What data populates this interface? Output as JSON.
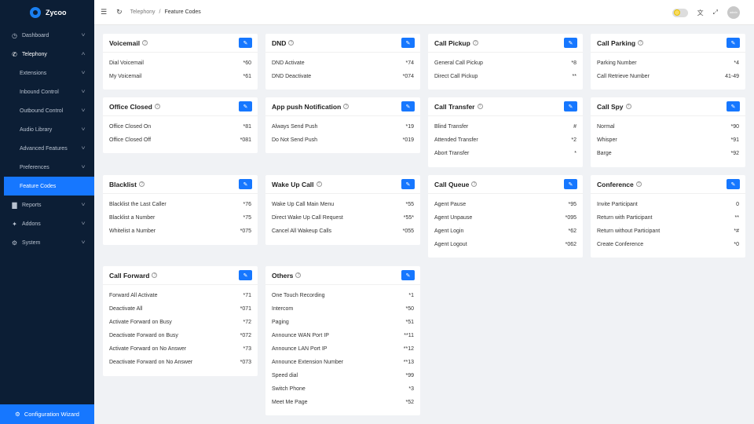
{
  "app": {
    "name": "Zycoo"
  },
  "sidebar": {
    "items": [
      {
        "label": "Dashboard",
        "icon": "dashboard-icon",
        "open": false
      },
      {
        "label": "Telephony",
        "icon": "phone-icon",
        "open": true
      },
      {
        "label": "Extensions",
        "sub": true
      },
      {
        "label": "Inbound Control",
        "sub": true
      },
      {
        "label": "Outbound Control",
        "sub": true
      },
      {
        "label": "Audio Library",
        "sub": true
      },
      {
        "label": "Advanced Features",
        "sub": true
      },
      {
        "label": "Preferences",
        "sub": true
      },
      {
        "label": "Feature Codes",
        "sub": true,
        "active": true
      },
      {
        "label": "Reports",
        "icon": "chart-icon"
      },
      {
        "label": "Addons",
        "icon": "addons-icon"
      },
      {
        "label": "System",
        "icon": "system-icon"
      }
    ],
    "wizard_label": "Configuration Wizard"
  },
  "header": {
    "breadcrumb": [
      "Telephony",
      "/",
      "Feature Codes"
    ],
    "avatar_text": "admin"
  },
  "cards": [
    {
      "title": "Voicemail",
      "rows": [
        [
          "Dial Voicemail",
          "*60"
        ],
        [
          "My Voicemail",
          "*61"
        ]
      ]
    },
    {
      "title": "DND",
      "rows": [
        [
          "DND Activate",
          "*74"
        ],
        [
          "DND Deactivate",
          "*074"
        ]
      ]
    },
    {
      "title": "Call Pickup",
      "rows": [
        [
          "General Call Pickup",
          "*8"
        ],
        [
          "Direct Call Pickup",
          "**"
        ]
      ]
    },
    {
      "title": "Call Parking",
      "rows": [
        [
          "Parking Number",
          "*4"
        ],
        [
          "Call Retrieve Number",
          "41-49"
        ]
      ]
    },
    {
      "title": "Office Closed",
      "rows": [
        [
          "Office Closed On",
          "*81"
        ],
        [
          "Office Closed Off",
          "*081"
        ]
      ]
    },
    {
      "title": "App push Notification",
      "rows": [
        [
          "Always Send Push",
          "*19"
        ],
        [
          "Do Not Send Push",
          "*019"
        ]
      ]
    },
    {
      "title": "Call Transfer",
      "rows": [
        [
          "Blind Transfer",
          "#"
        ],
        [
          "Attended Transfer",
          "*2"
        ],
        [
          "Abort Transfer",
          "*"
        ]
      ]
    },
    {
      "title": "Call Spy",
      "rows": [
        [
          "Normal",
          "*90"
        ],
        [
          "Whisper",
          "*91"
        ],
        [
          "Barge",
          "*92"
        ]
      ]
    },
    {
      "title": "Blacklist",
      "rows": [
        [
          "Blacklist the Last Caller",
          "*76"
        ],
        [
          "Blacklist a Number",
          "*75"
        ],
        [
          "Whitelist a Number",
          "*075"
        ]
      ]
    },
    {
      "title": "Wake Up Call",
      "rows": [
        [
          "Wake Up Call Main Menu",
          "*55"
        ],
        [
          "Direct Wake Up Call Request",
          "*55*"
        ],
        [
          "Cancel All Wakeup Calls",
          "*055"
        ]
      ]
    },
    {
      "title": "Call Queue",
      "rows": [
        [
          "Agent Pause",
          "*95"
        ],
        [
          "Agent Unpause",
          "*095"
        ],
        [
          "Agent Login",
          "*62"
        ],
        [
          "Agent Logout",
          "*062"
        ]
      ]
    },
    {
      "title": "Conference",
      "rows": [
        [
          "Invite Participant",
          "0"
        ],
        [
          "Return with Participant",
          "**"
        ],
        [
          "Return without Participant",
          "*#"
        ],
        [
          "Create Conference",
          "*0"
        ]
      ]
    },
    {
      "title": "Call Forward",
      "rows": [
        [
          "Forward All Activate",
          "*71"
        ],
        [
          "Deactivate All",
          "*071"
        ],
        [
          "Activate Forward on Busy",
          "*72"
        ],
        [
          "Deactivate Forward on Busy",
          "*072"
        ],
        [
          "Activate Forward on No Answer",
          "*73"
        ],
        [
          "Deactivate Forward on No Answer",
          "*073"
        ]
      ]
    },
    {
      "title": "Others",
      "rows": [
        [
          "One Touch Recording",
          "*1"
        ],
        [
          "Intercom",
          "*50"
        ],
        [
          "Paging",
          "*51"
        ],
        [
          "Announce WAN Port IP",
          "**11"
        ],
        [
          "Announce LAN Port IP",
          "**12"
        ],
        [
          "Announce Extension Number",
          "**13"
        ],
        [
          "Speed dial",
          "*99"
        ],
        [
          "Switch Phone",
          "*3"
        ],
        [
          "Meet Me Page",
          "*52"
        ]
      ]
    }
  ],
  "colors": {
    "sidebar_bg": "#0c1e35",
    "accent": "#1677ff",
    "page_bg": "#f0f2f5"
  }
}
